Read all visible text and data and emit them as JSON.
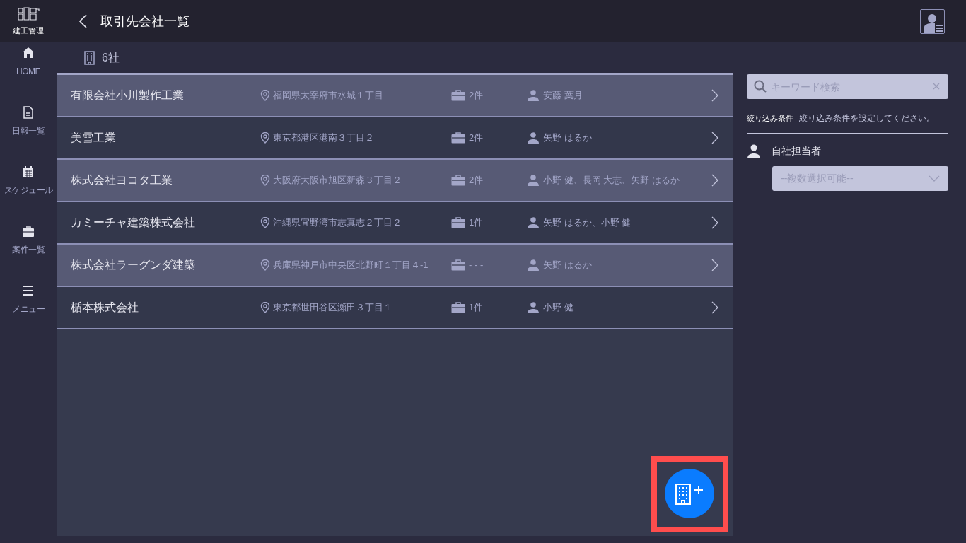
{
  "app": {
    "logo_text": "建工管理"
  },
  "header": {
    "title": "取引先会社一覧"
  },
  "sidebar": {
    "items": [
      {
        "kind": "home",
        "label": "HOME"
      },
      {
        "kind": "report",
        "label": "日報一覧"
      },
      {
        "kind": "calendar",
        "label": "スケジュール"
      },
      {
        "kind": "case",
        "label": "案件一覧"
      },
      {
        "kind": "menu",
        "label": "メニュー"
      }
    ]
  },
  "summary": {
    "count": "6社"
  },
  "companies": [
    {
      "name": "有限会社小川製作工業",
      "address": "福岡県太宰府市水城１丁目",
      "cases": "2件",
      "staff": "安藤 葉月"
    },
    {
      "name": "美雪工業",
      "address": "東京都港区港南３丁目２",
      "cases": "2件",
      "staff": "矢野 はるか"
    },
    {
      "name": "株式会社ヨコタ工業",
      "address": "大阪府大阪市旭区新森３丁目２",
      "cases": "2件",
      "staff": "小野 健、長岡 大志、矢野 はるか"
    },
    {
      "name": "カミーチャ建築株式会社",
      "address": "沖縄県宜野湾市志真志２丁目２",
      "cases": "1件",
      "staff": "矢野 はるか、小野 健"
    },
    {
      "name": "株式会社ラーグンダ建築",
      "address": "兵庫県神戸市中央区北野町１丁目４-1",
      "cases": "- - -",
      "staff": "矢野 はるか"
    },
    {
      "name": "楯本株式会社",
      "address": "東京都世田谷区瀬田３丁目１",
      "cases": "1件",
      "staff": "小野 健"
    }
  ],
  "search": {
    "placeholder": "キーワード検索"
  },
  "filter": {
    "label": "絞り込み条件",
    "hint": "絞り込み条件を設定してください。",
    "field_label": "自社担当者",
    "select_placeholder": "--複数選択可能--"
  }
}
